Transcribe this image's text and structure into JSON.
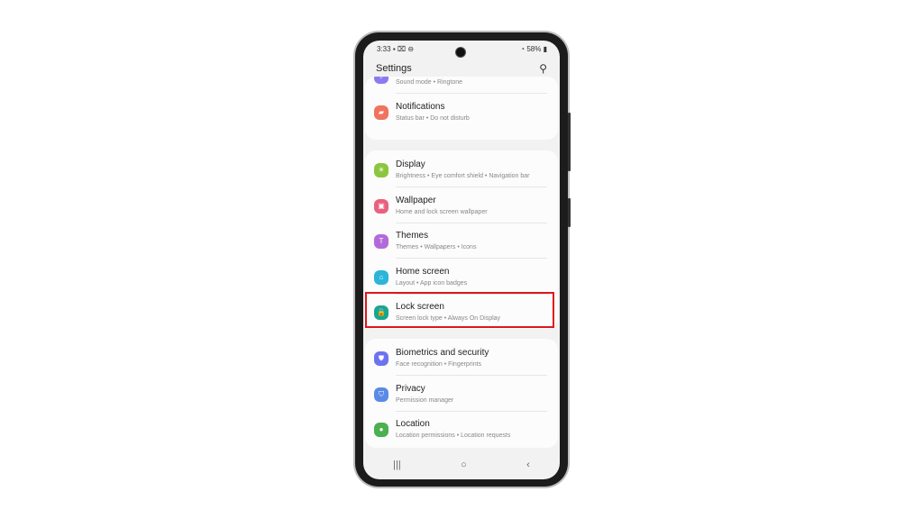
{
  "status": {
    "time": "3:33",
    "icons": "▪ ⌧ ⊖",
    "battery": "58%"
  },
  "header": {
    "title": "Settings",
    "search_icon": "search-icon"
  },
  "groups": [
    [
      {
        "title": "",
        "subtitle": "Sound mode • Ringtone",
        "color": "#8a7cf0",
        "icon": "♪"
      },
      {
        "title": "Notifications",
        "subtitle": "Status bar • Do not disturb",
        "color": "#f0735f",
        "icon": "▰"
      }
    ],
    [
      {
        "title": "Display",
        "subtitle": "Brightness • Eye comfort shield • Navigation bar",
        "color": "#8cc63f",
        "icon": "☀"
      },
      {
        "title": "Wallpaper",
        "subtitle": "Home and lock screen wallpaper",
        "color": "#e8627f",
        "icon": "▣"
      },
      {
        "title": "Themes",
        "subtitle": "Themes • Wallpapers • Icons",
        "color": "#b36ad9",
        "icon": "T"
      },
      {
        "title": "Home screen",
        "subtitle": "Layout • App icon badges",
        "color": "#2bb5d8",
        "icon": "⌂"
      },
      {
        "title": "Lock screen",
        "subtitle": "Screen lock type • Always On Display",
        "color": "#1aa58e",
        "icon": "🔒"
      }
    ],
    [
      {
        "title": "Biometrics and security",
        "subtitle": "Face recognition • Fingerprints",
        "color": "#6d73ef",
        "icon": "⛊"
      },
      {
        "title": "Privacy",
        "subtitle": "Permission manager",
        "color": "#5b8ae6",
        "icon": "⛉"
      },
      {
        "title": "Location",
        "subtitle": "Location permissions • Location requests",
        "color": "#4caf50",
        "icon": "●"
      }
    ]
  ],
  "nav": {
    "recents": "|||",
    "home": "○",
    "back": "‹"
  },
  "highlight_color": "#e0161b"
}
